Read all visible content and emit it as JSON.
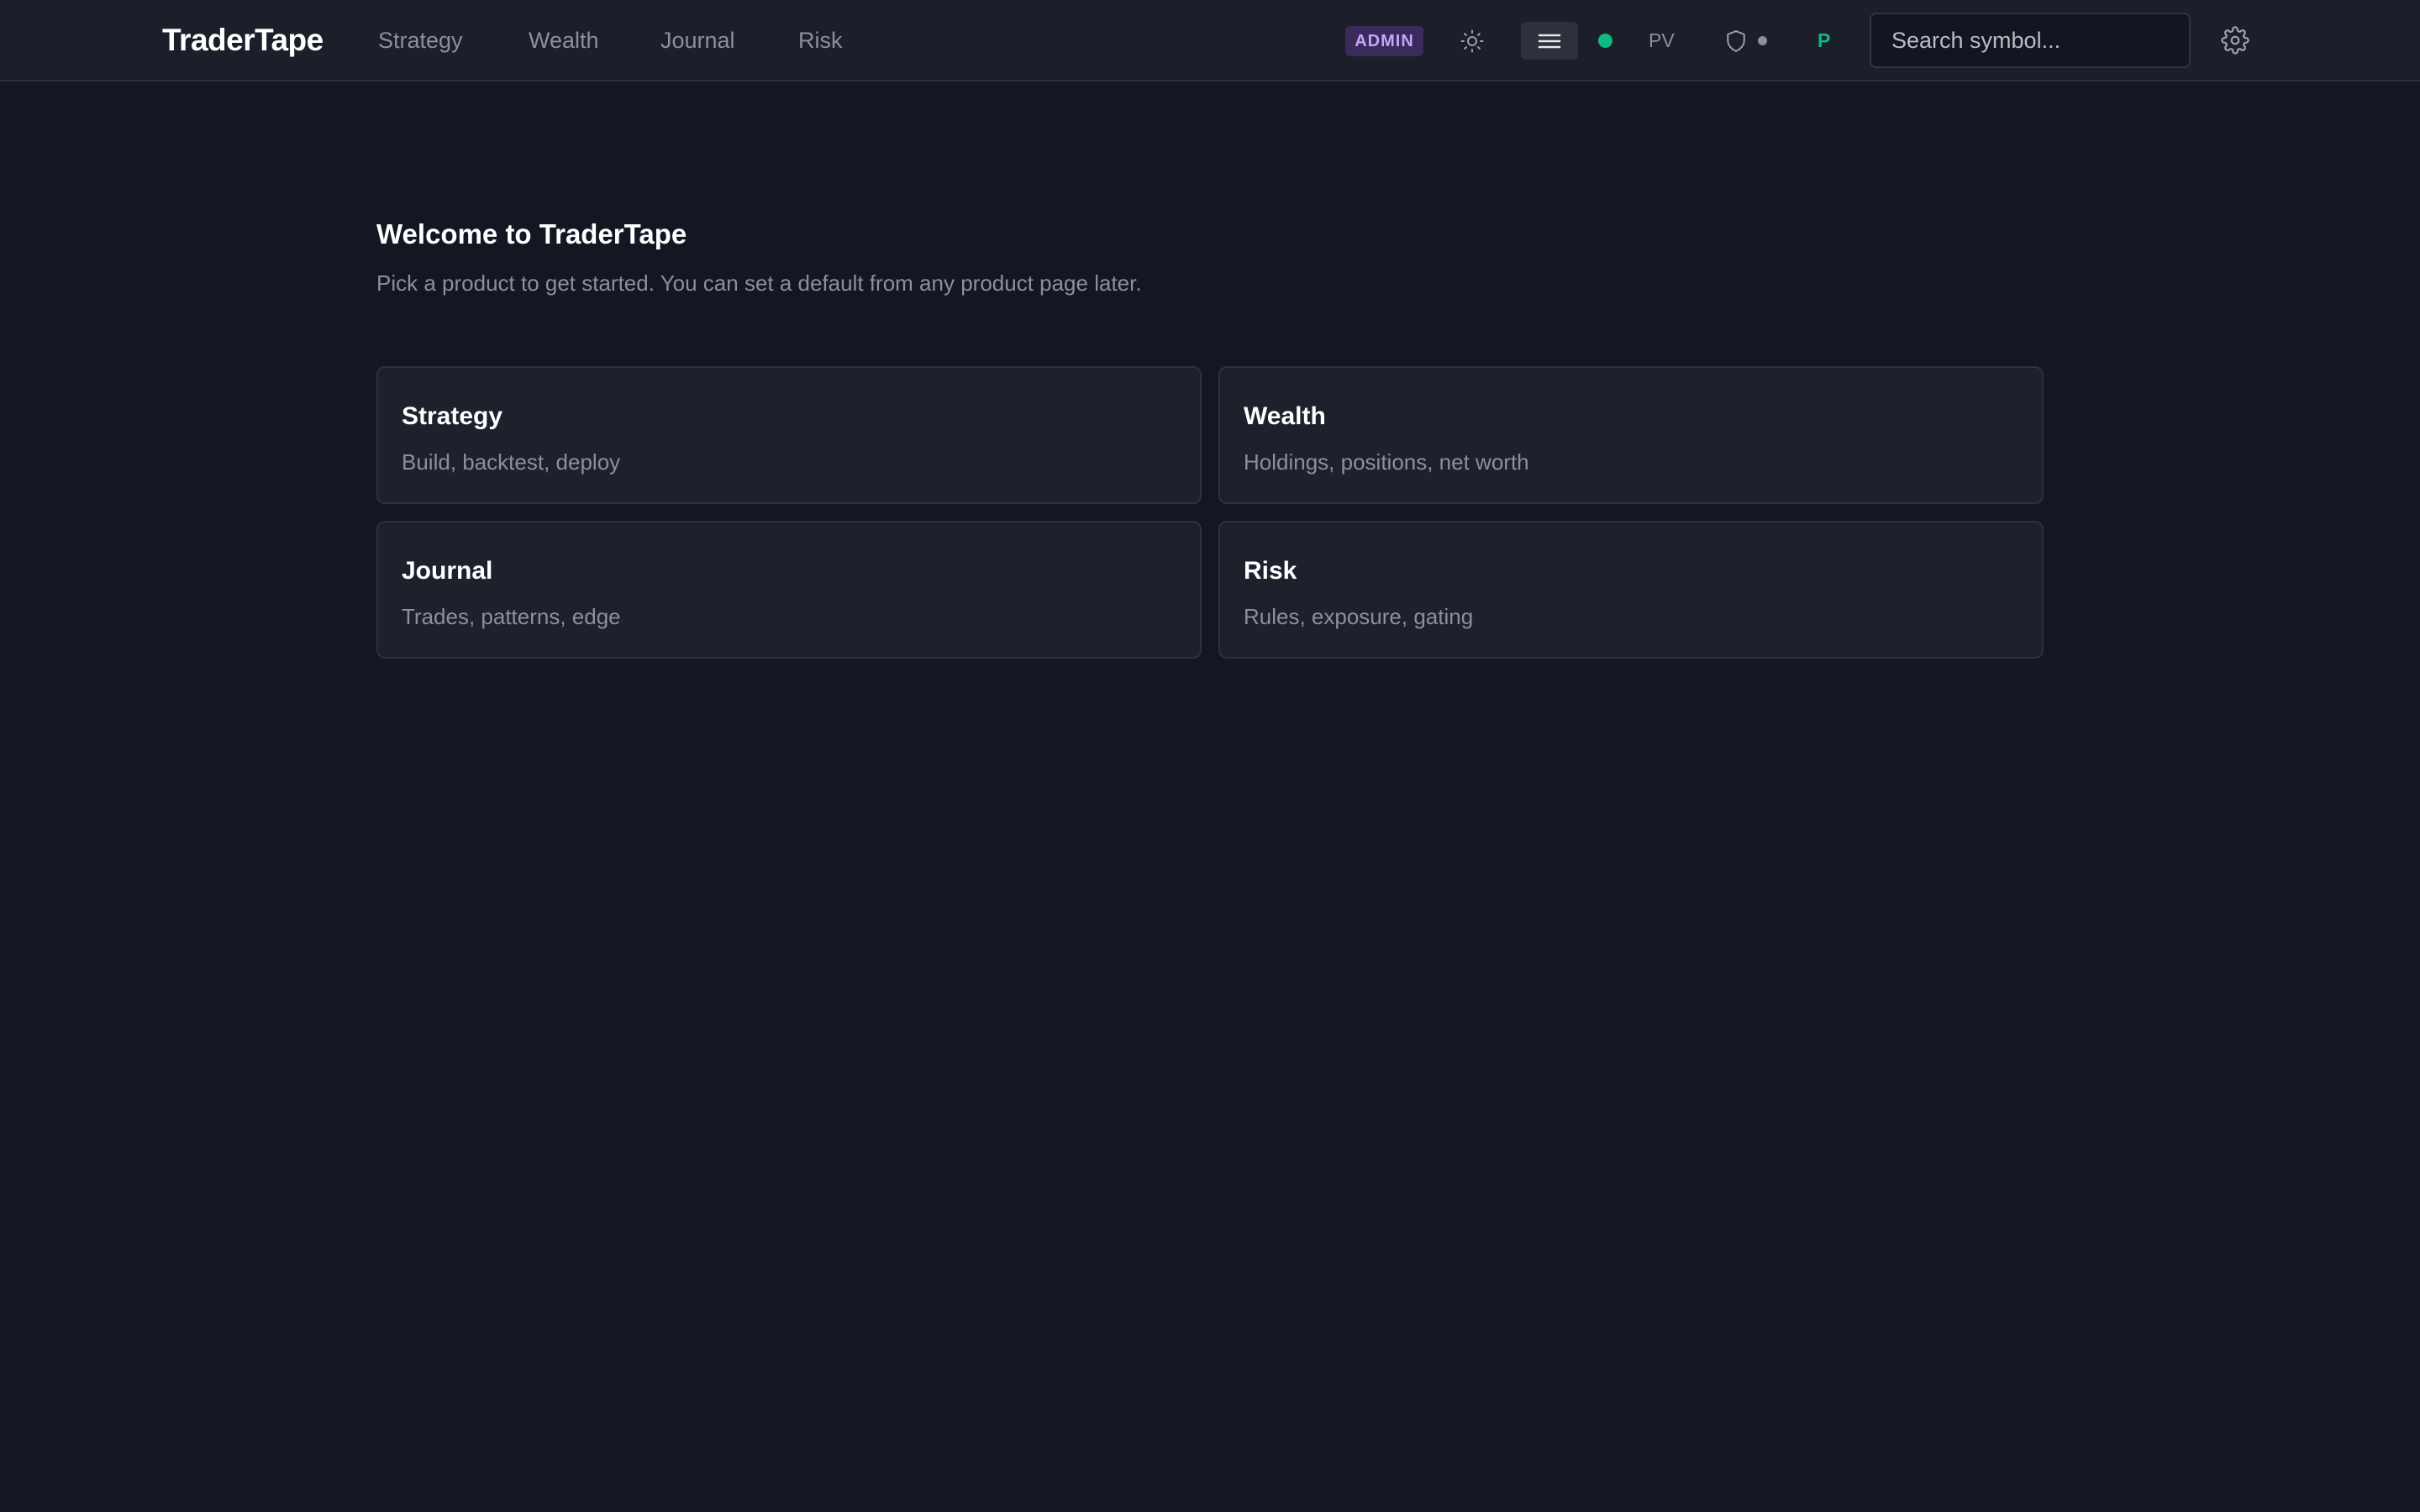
{
  "header": {
    "brand": "TraderTape",
    "nav": [
      {
        "label": "Strategy"
      },
      {
        "label": "Wealth"
      },
      {
        "label": "Journal"
      },
      {
        "label": "Risk"
      }
    ],
    "admin_badge": "ADMIN",
    "theme_icon": "sun-icon",
    "menu_icon": "hamburger-menu-icon",
    "status_color": "#10b981",
    "pv_label": "PV",
    "shield_icon": "shield-icon",
    "p_label": "P",
    "search": {
      "placeholder": "Search symbol...",
      "value": ""
    },
    "settings_icon": "gear-icon"
  },
  "main": {
    "title": "Welcome to TraderTape",
    "subtitle": "Pick a product to get started. You can set a default from any product page later.",
    "products": [
      {
        "title": "Strategy",
        "description": "Build, backtest, deploy"
      },
      {
        "title": "Wealth",
        "description": "Holdings, positions, net worth"
      },
      {
        "title": "Journal",
        "description": "Trades, patterns, edge"
      },
      {
        "title": "Risk",
        "description": "Rules, exposure, gating"
      }
    ]
  },
  "colors": {
    "background": "#131722",
    "header_bg": "#1b1f29",
    "card_bg": "#1d212c",
    "accent_green": "#10b981",
    "admin_purple": "#c4a6f7"
  }
}
